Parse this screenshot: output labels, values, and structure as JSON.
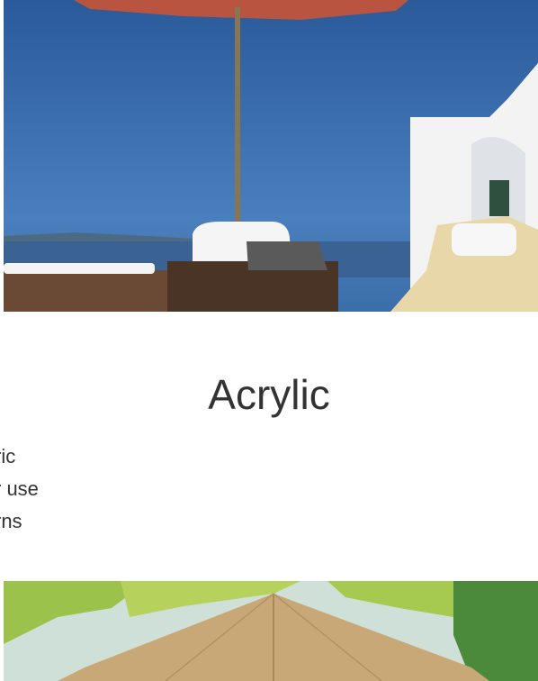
{
  "images": {
    "top": {
      "alt": "Patio umbrella on a white terrace overlooking the sea"
    },
    "bottom": {
      "alt": "Thatched palapa umbrella beneath palm trees"
    }
  },
  "section": {
    "heading": "Acrylic",
    "features": [
      "ric",
      "r use",
      "rns"
    ]
  },
  "colors": {
    "text": "#333333",
    "sky": "#3a6aa6",
    "canopy": "#b8543f",
    "thatch": "#c9a878"
  }
}
